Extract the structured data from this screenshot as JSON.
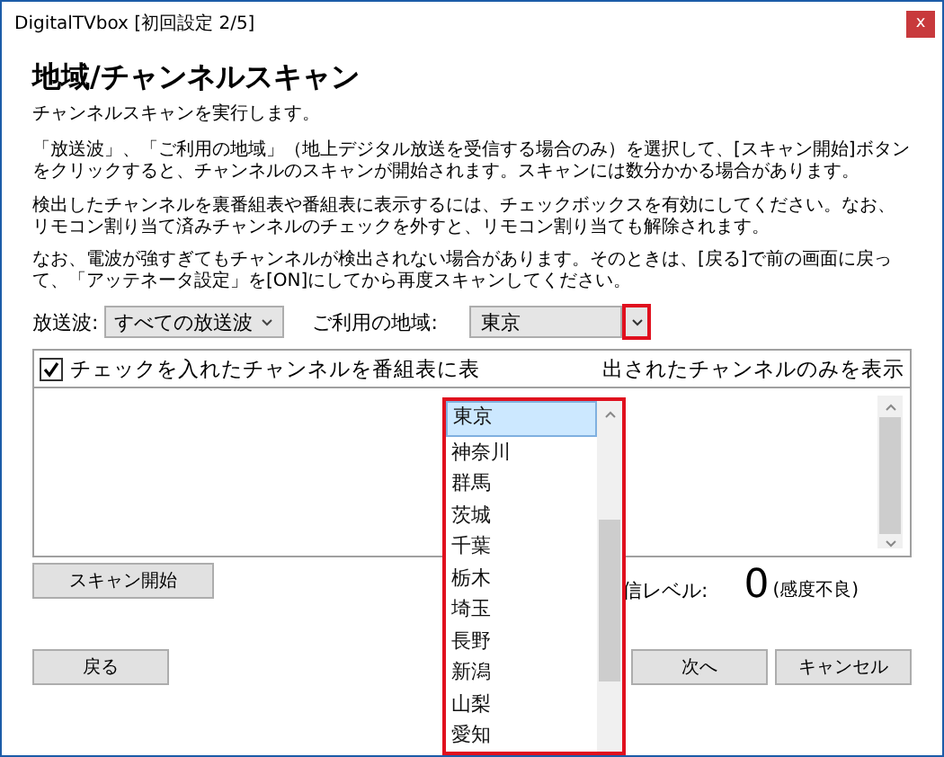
{
  "window": {
    "title": "DigitalTVbox [初回設定 2/5]",
    "close": "x"
  },
  "heading": "地域/チャンネルスキャン",
  "paragraphs": [
    "チャンネルスキャンを実行します。",
    "「放送波」、「ご利用の地域」（地上デジタル放送を受信する場合のみ）を選択して、[スキャン開始]ボタンをクリックすると、チャンネルのスキャンが開始されます。スキャンには数分かかる場合があります。",
    "検出したチャンネルを裏番組表や番組表に表示するには、チェックボックスを有効にしてください。なお、リモコン割り当て済みチャンネルのチェックを外すと、リモコン割り当ても解除されます。",
    "なお、電波が強すぎてもチャンネルが検出されない場合があります。そのときは、[戻る]で前の画面に戻って、「アッテネータ設定」を[ON]にしてから再度スキャンしてください。"
  ],
  "broadcast": {
    "label": "放送波:",
    "value": "すべての放送波"
  },
  "region": {
    "label": "ご利用の地域:",
    "value": "東京",
    "expanded": true,
    "options": [
      {
        "label": "東京",
        "selected": true
      },
      {
        "label": "神奈川",
        "selected": false
      },
      {
        "label": "群馬",
        "selected": false
      },
      {
        "label": "茨城",
        "selected": false
      },
      {
        "label": "千葉",
        "selected": false
      },
      {
        "label": "栃木",
        "selected": false
      },
      {
        "label": "埼玉",
        "selected": false
      },
      {
        "label": "長野",
        "selected": false
      },
      {
        "label": "新潟",
        "selected": false
      },
      {
        "label": "山梨",
        "selected": false
      },
      {
        "label": "愛知",
        "selected": false
      }
    ]
  },
  "channel_list": {
    "checked": true,
    "header_left": "チェックを入れたチャンネルを番組表に表",
    "header_right": "出されたチャンネルのみを表示"
  },
  "scan_button": "スキャン開始",
  "signal": {
    "label": "信レベル:",
    "value": "0",
    "status": "(感度不良)"
  },
  "buttons": {
    "back": "戻る",
    "next": "次へ",
    "cancel": "キャンセル"
  }
}
